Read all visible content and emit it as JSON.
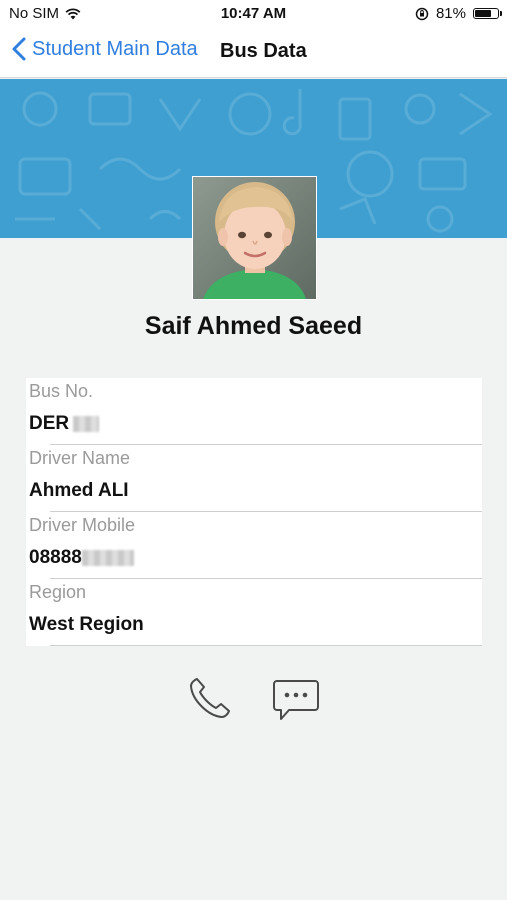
{
  "status_bar": {
    "carrier": "No SIM",
    "time": "10:47 AM",
    "battery_percent": "81%",
    "battery_level": 0.81
  },
  "nav": {
    "back_label": "Student Main Data",
    "title": "Bus Data"
  },
  "student": {
    "name": "Saif Ahmed Saeed"
  },
  "info": {
    "bus_no_label": "Bus No.",
    "bus_no_value": "DER",
    "driver_name_label": "Driver Name",
    "driver_name_value": "Ahmed ALI",
    "driver_mobile_label": "Driver Mobile",
    "driver_mobile_value": "08888",
    "region_label": "Region",
    "region_value": "West Region"
  },
  "icons": {
    "call": "phone-icon",
    "message": "message-bubble-icon",
    "wifi": "wifi-icon",
    "rotation_lock": "rotation-lock-icon",
    "back": "chevron-left-icon"
  },
  "colors": {
    "accent": "#2f7ee0",
    "banner": "#3e9fd0",
    "background": "#f1f2f2"
  }
}
